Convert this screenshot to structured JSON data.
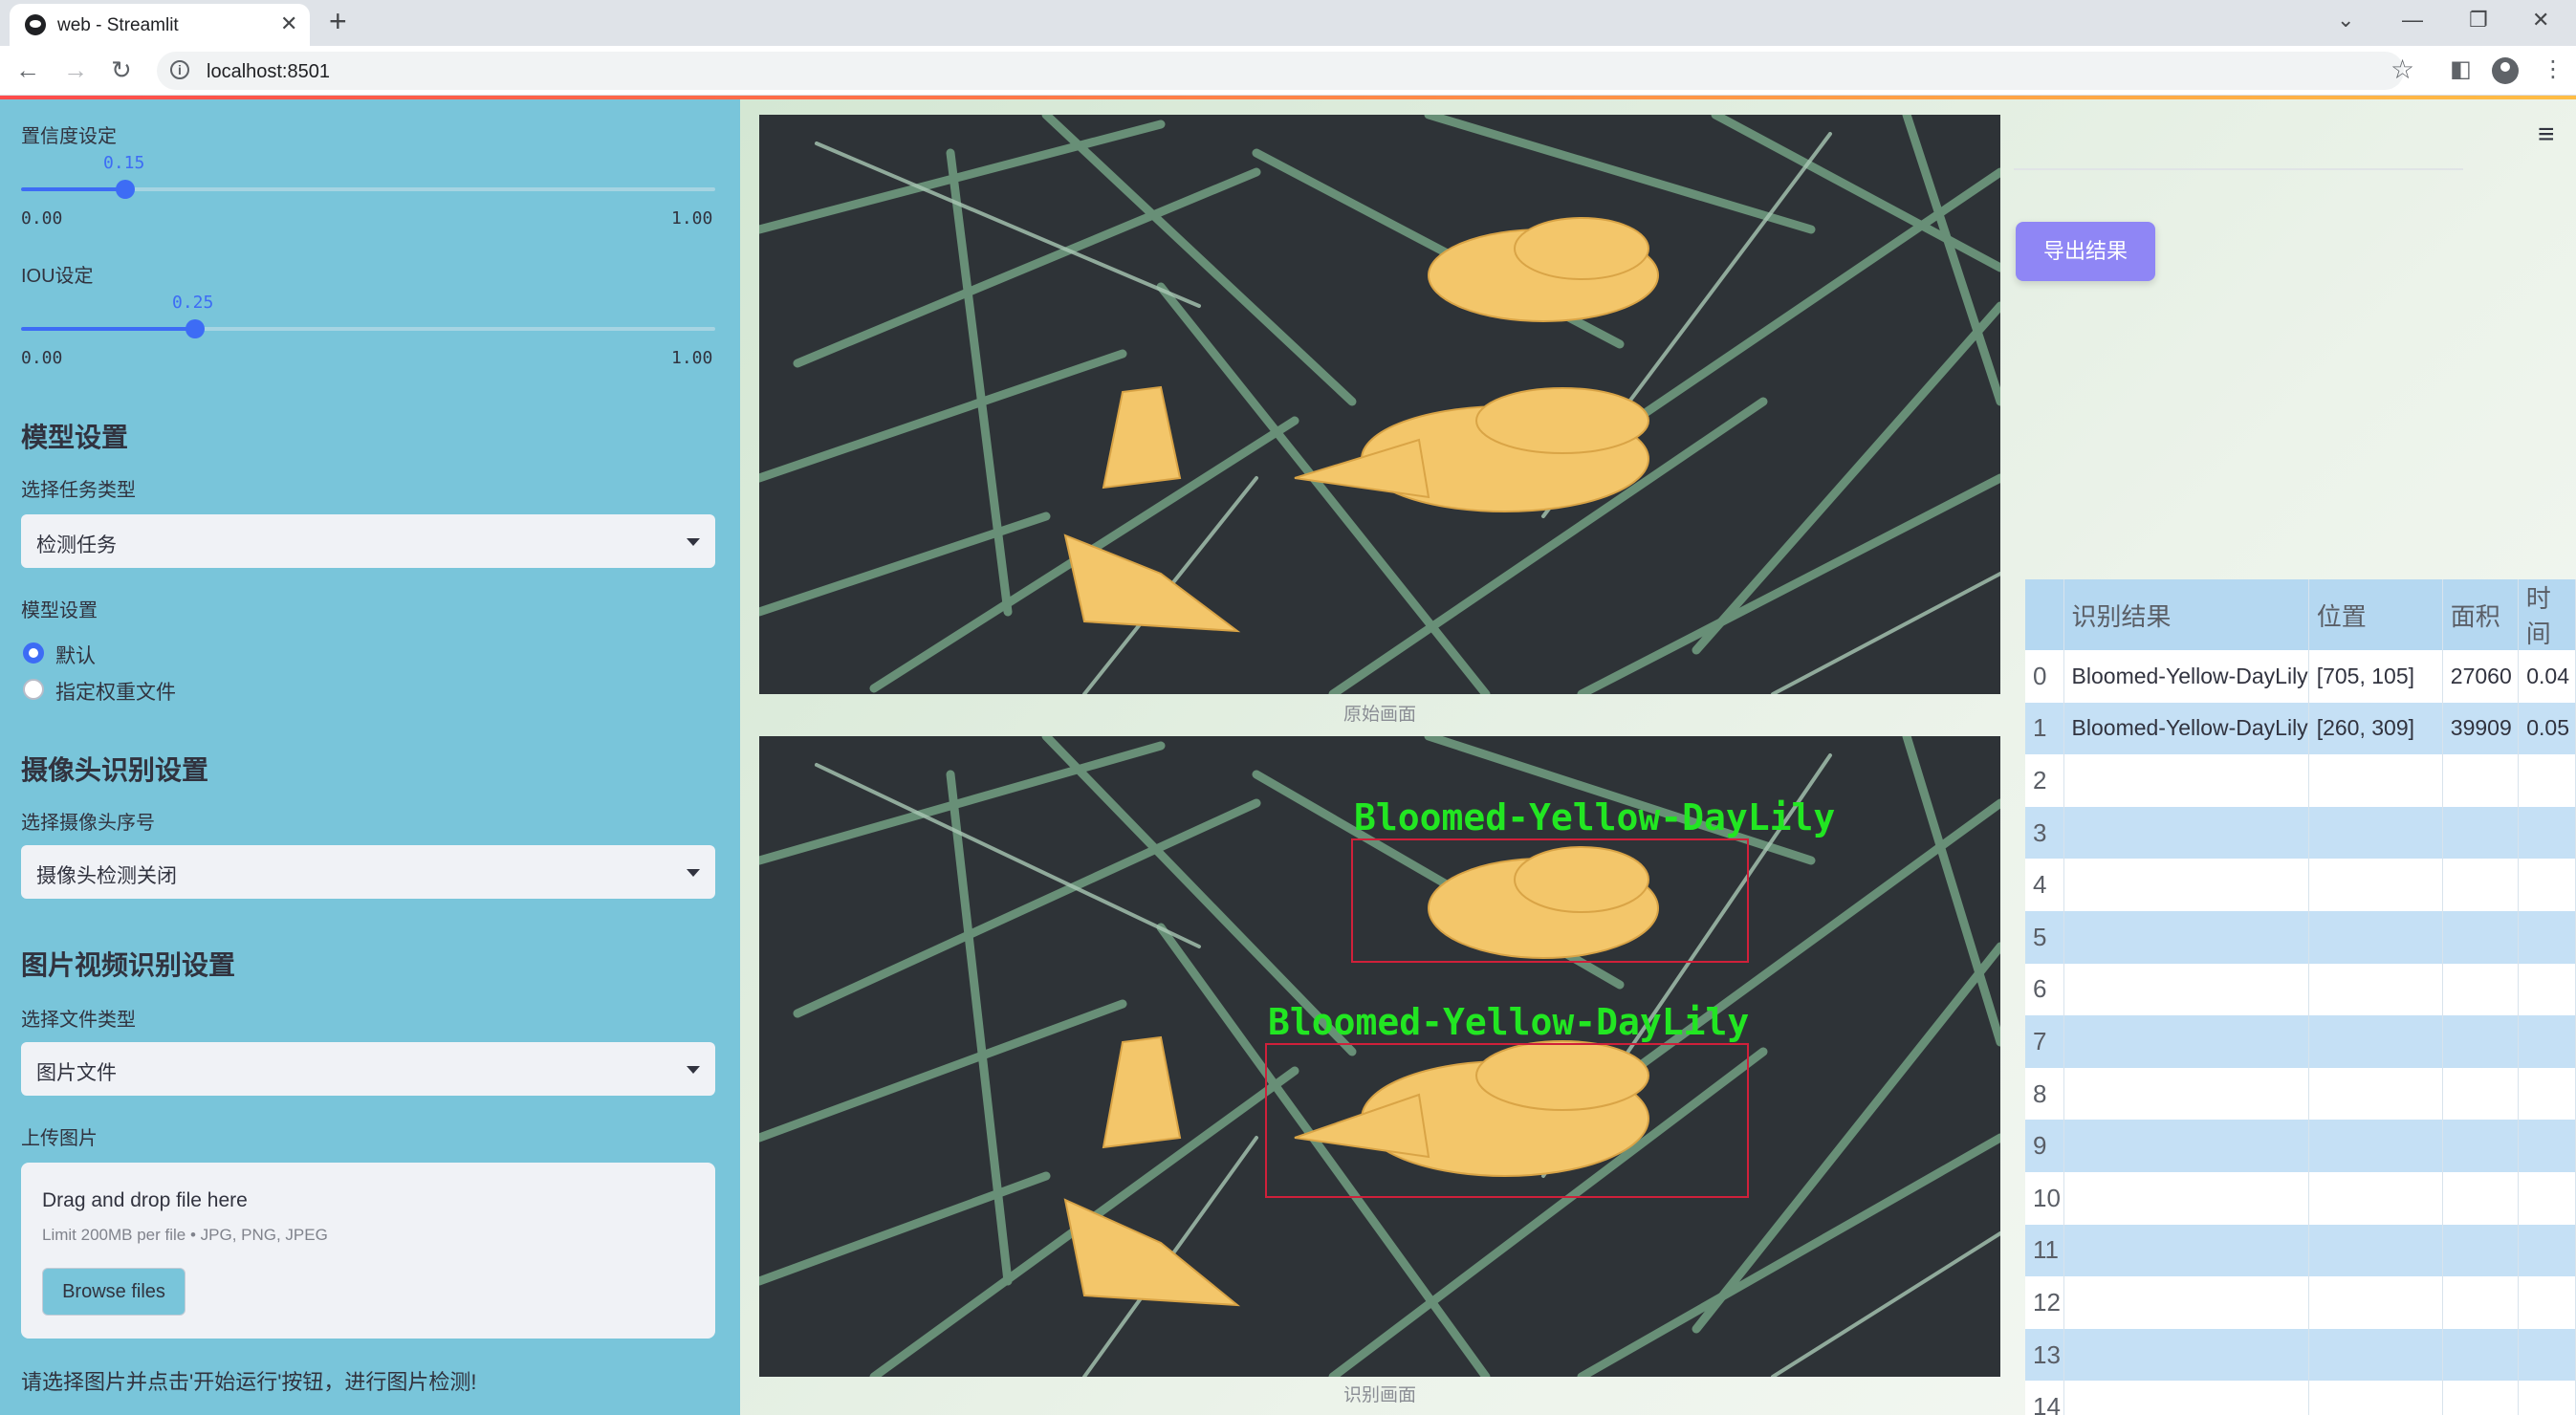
{
  "browser": {
    "tab_title": "web - Streamlit",
    "url": "localhost:8501"
  },
  "sidebar": {
    "confidence": {
      "label": "置信度设定",
      "value": "0.15",
      "fraction": 0.15,
      "min": "0.00",
      "max": "1.00"
    },
    "iou": {
      "label": "IOU设定",
      "value": "0.25",
      "fraction": 0.25,
      "min": "0.00",
      "max": "1.00"
    },
    "model_section": {
      "header": "模型设置",
      "task_label": "选择任务类型",
      "task_value": "检测任务",
      "model_label": "模型设置",
      "options": [
        {
          "label": "默认",
          "selected": true
        },
        {
          "label": "指定权重文件",
          "selected": false
        }
      ]
    },
    "camera_section": {
      "header": "摄像头识别设置",
      "camera_label": "选择摄像头序号",
      "camera_value": "摄像头检测关闭"
    },
    "media_section": {
      "header": "图片视频识别设置",
      "filetype_label": "选择文件类型",
      "filetype_value": "图片文件",
      "upload_label": "上传图片",
      "drop_text": "Drag and drop file here",
      "limit_text": "Limit 200MB per file • JPG, PNG, JPEG",
      "browse_label": "Browse files"
    },
    "hint": "请选择图片并点击'开始运行'按钮，进行图片检测!"
  },
  "main": {
    "original_caption": "原始画面",
    "detected_caption": "识别画面",
    "export_label": "导出结果",
    "detections": [
      {
        "label": "Bloomed-Yellow-DayLily"
      },
      {
        "label": "Bloomed-Yellow-DayLily"
      }
    ],
    "table": {
      "columns": [
        "识别结果",
        "位置",
        "面积",
        "时间"
      ],
      "rows": [
        {
          "index": "0",
          "result": "Bloomed-Yellow-DayLily",
          "position": "[705, 105]",
          "area": "27060",
          "time": "0.04"
        },
        {
          "index": "1",
          "result": "Bloomed-Yellow-DayLily",
          "position": "[260, 309]",
          "area": "39909",
          "time": "0.05"
        },
        {
          "index": "2",
          "result": "",
          "position": "",
          "area": "",
          "time": ""
        },
        {
          "index": "3",
          "result": "",
          "position": "",
          "area": "",
          "time": ""
        },
        {
          "index": "4",
          "result": "",
          "position": "",
          "area": "",
          "time": ""
        },
        {
          "index": "5",
          "result": "",
          "position": "",
          "area": "",
          "time": ""
        },
        {
          "index": "6",
          "result": "",
          "position": "",
          "area": "",
          "time": ""
        },
        {
          "index": "7",
          "result": "",
          "position": "",
          "area": "",
          "time": ""
        },
        {
          "index": "8",
          "result": "",
          "position": "",
          "area": "",
          "time": ""
        },
        {
          "index": "9",
          "result": "",
          "position": "",
          "area": "",
          "time": ""
        },
        {
          "index": "10",
          "result": "",
          "position": "",
          "area": "",
          "time": ""
        },
        {
          "index": "11",
          "result": "",
          "position": "",
          "area": "",
          "time": ""
        },
        {
          "index": "12",
          "result": "",
          "position": "",
          "area": "",
          "time": ""
        },
        {
          "index": "13",
          "result": "",
          "position": "",
          "area": "",
          "time": ""
        },
        {
          "index": "14",
          "result": "",
          "position": "",
          "area": "",
          "time": ""
        }
      ]
    }
  },
  "colors": {
    "sidebar_bg": "#79c5da",
    "accent_blue": "#3d6cf5",
    "export_button": "#8f86f5",
    "detection_box": "#d0203a",
    "detection_label": "#22e622",
    "table_header": "#b5d8f1",
    "table_alt_row": "#c5e0f5"
  }
}
